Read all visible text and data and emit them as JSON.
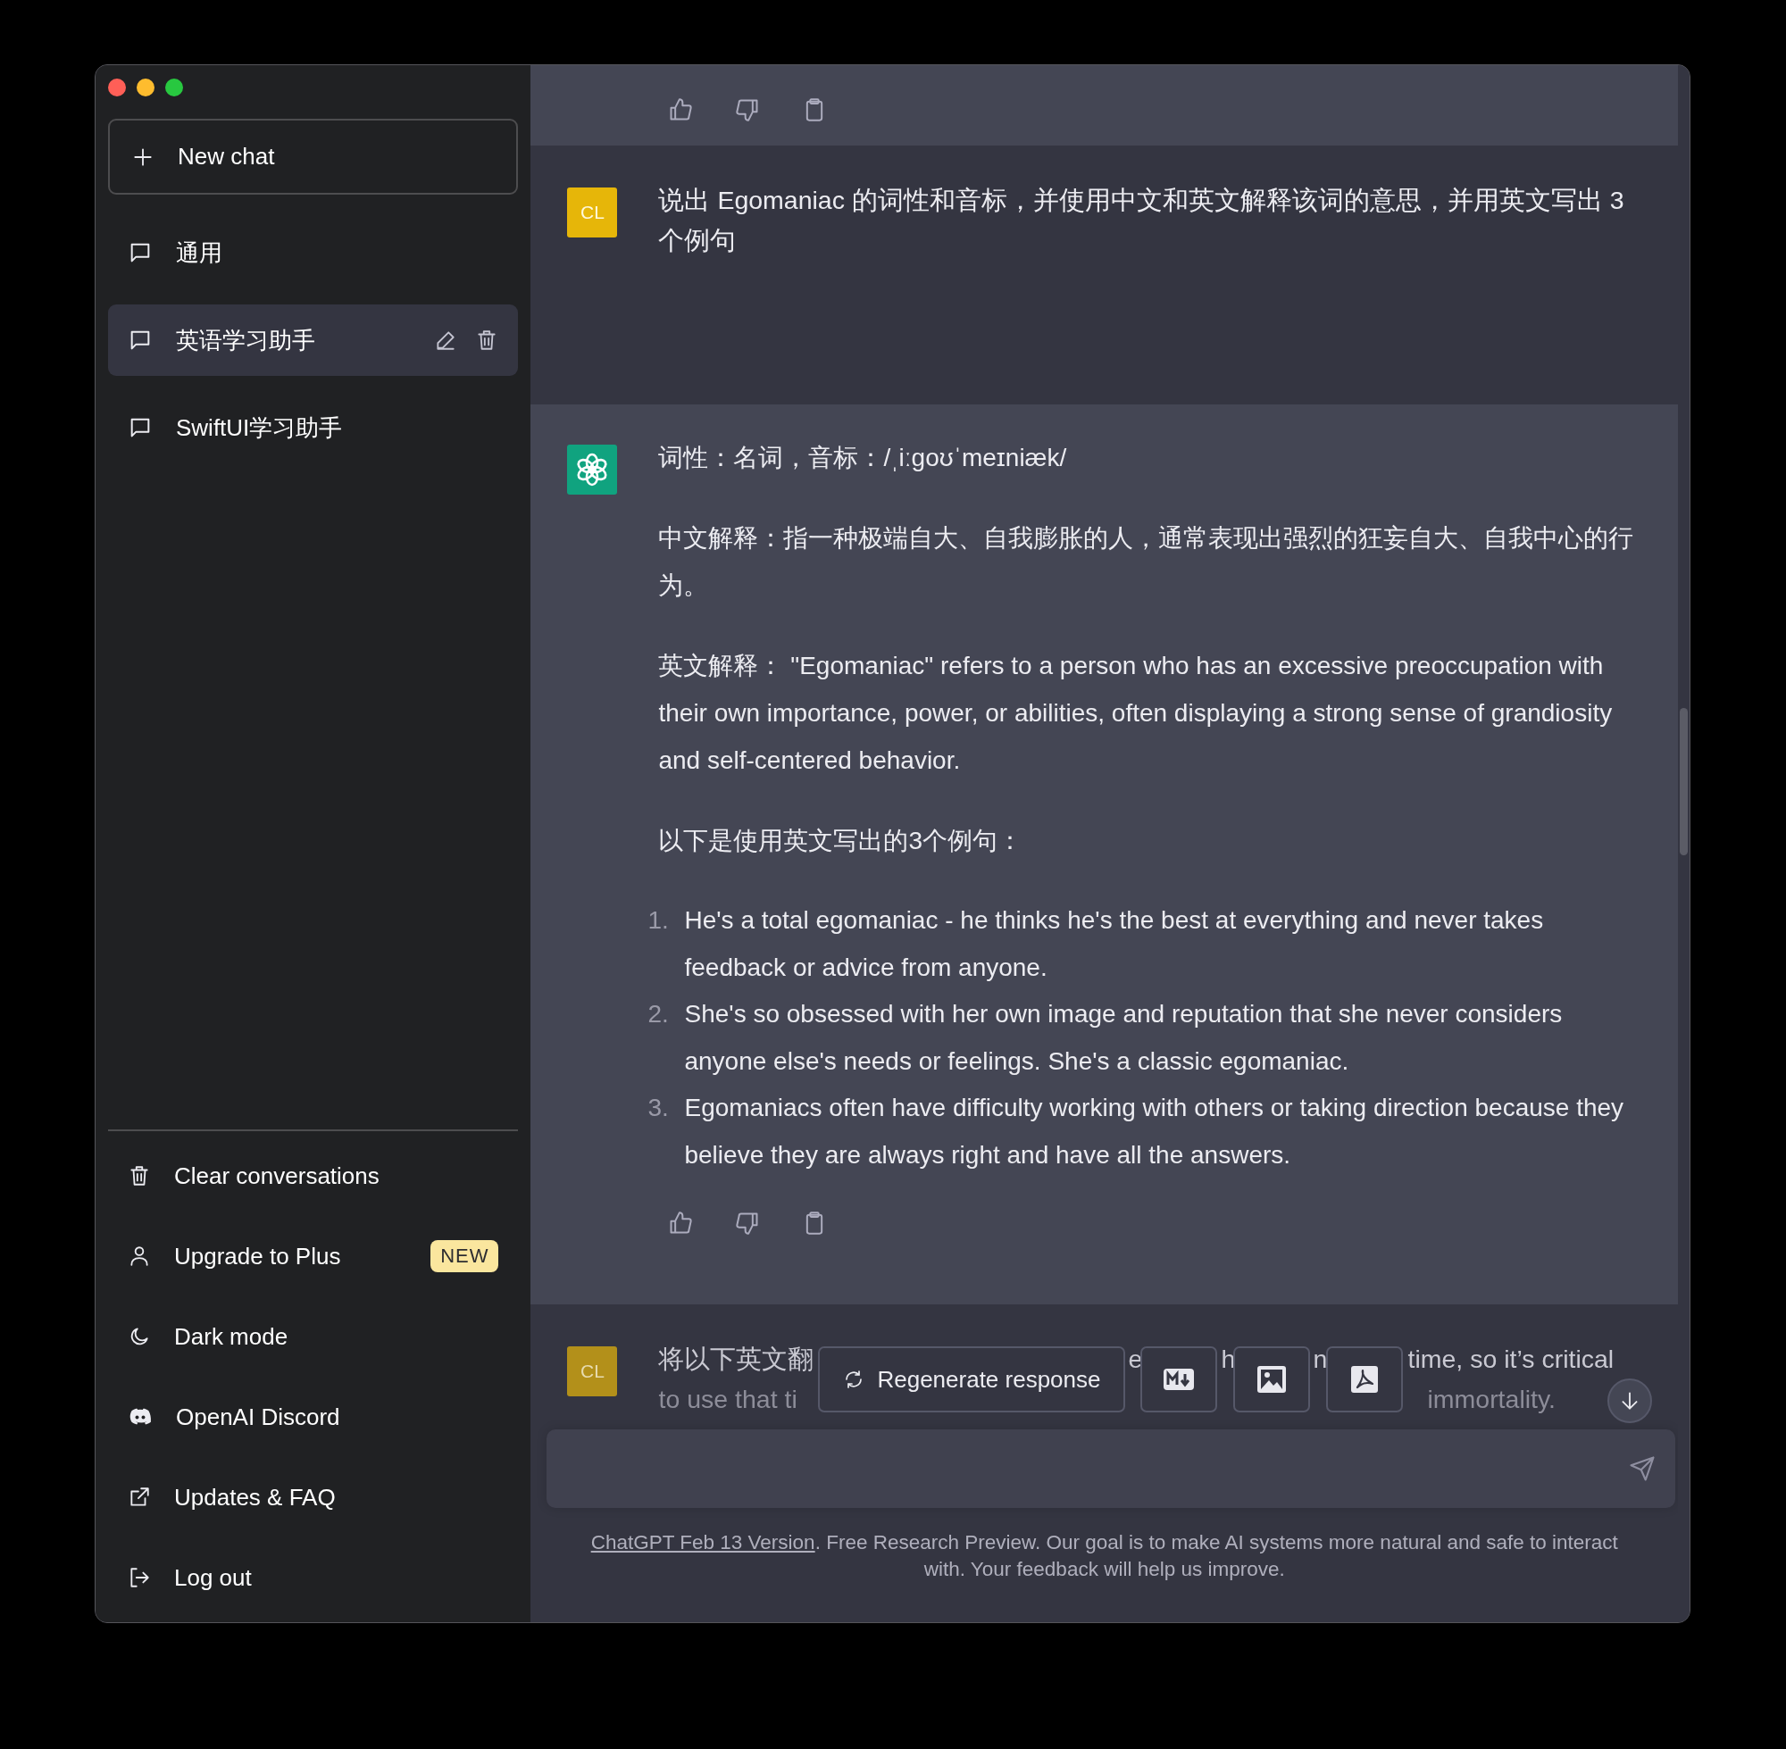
{
  "window": {
    "controls": [
      {
        "color": "#ff5f57"
      },
      {
        "color": "#febc2e"
      },
      {
        "color": "#28c840"
      }
    ]
  },
  "sidebar": {
    "new_chat": "New chat",
    "conversations": [
      {
        "title": "通用",
        "selected": false
      },
      {
        "title": "英语学习助手",
        "selected": true
      },
      {
        "title": "SwiftUI学习助手",
        "selected": false
      }
    ],
    "menu": [
      {
        "kind": "trash",
        "label": "Clear conversations"
      },
      {
        "kind": "user",
        "label": "Upgrade to Plus",
        "badge": "NEW"
      },
      {
        "kind": "moon",
        "label": "Dark mode"
      },
      {
        "kind": "discord",
        "label": "OpenAI Discord"
      },
      {
        "kind": "external",
        "label": "Updates & FAQ"
      },
      {
        "kind": "logout",
        "label": "Log out"
      }
    ]
  },
  "messages": [
    {
      "kind": "answer"
    },
    {
      "kind": "question",
      "avatar": "CL",
      "text": "说出 Egomaniac 的词性和音标，并使用中文和英文解释该词的意思，并用英文写出 3 个例句"
    },
    {
      "kind": "answer",
      "paragraphs": [
        "词性：名词，音标：/ˌiːɡoʊˈmeɪniæk/",
        "中文解释：指一种极端自大、自我膨胀的人，通常表现出强烈的狂妄自大、自我中心的行为。",
        "英文解释： \"Egomaniac\" refers to a person who has an excessive preoccupation with their own importance, power, or abilities, often displaying a strong sense of grandiosity and self-centered behavior.",
        "以下是使用英文写出的3个例句："
      ],
      "list": [
        {
          "number": "1.",
          "text": "He's a total egomaniac - he thinks he's the best at everything and never takes feedback or advice from anyone."
        },
        {
          "number": "2.",
          "text": "She's so obsessed with her own image and reputation that she never considers anyone else's needs or feelings. She's a classic egomaniac."
        },
        {
          "number": "3.",
          "text": "Egomaniacs often have difficulty working with others or taking direction because they believe they are always right and have all the answers."
        }
      ]
    },
    {
      "kind": "question",
      "avatar": "CL",
      "fragments": [
        [
          "将以下英文翻",
          "e",
          "h",
          "n",
          "time, so it’s critical"
        ],
        [
          "to use that ti",
          "immortality."
        ]
      ]
    }
  ],
  "overlay": {
    "regenerate": "Regenerate response",
    "exports": [
      {
        "kind": "markdown"
      },
      {
        "kind": "image"
      },
      {
        "kind": "pdf"
      }
    ]
  },
  "footer": {
    "link": "ChatGPT Feb 13 Version",
    "text": ". Free Research Preview. Our goal is to make AI systems more natural and safe to interact with. Your feedback will help us improve."
  }
}
